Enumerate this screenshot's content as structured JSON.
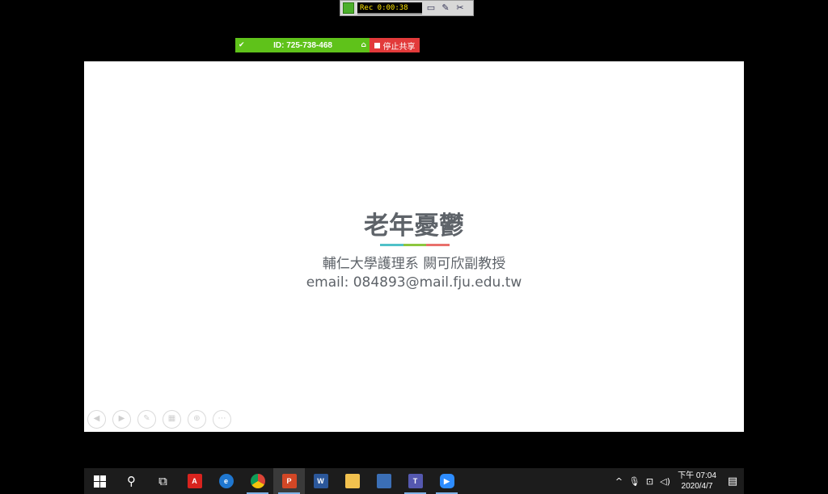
{
  "recorder": {
    "time": "Rec 0:00:38"
  },
  "share_bar": {
    "meeting_id": "ID: 725-738-468",
    "stop_label": "停止共享"
  },
  "slide": {
    "title": "老年憂鬱",
    "subtitle_line1": "輔仁大學護理系 闕可欣副教授",
    "subtitle_line2": "email: 084893@mail.fju.edu.tw",
    "rule_colors": [
      "#4fc1c8",
      "#8dc63f",
      "#e9706b"
    ]
  },
  "taskbar": {
    "apps": [
      "windows-start",
      "search",
      "task-view",
      "acrobat",
      "edge",
      "chrome",
      "powerpoint",
      "word",
      "file-explorer",
      "remote-app",
      "teams",
      "zoom"
    ],
    "clock_time": "下午 07:04",
    "clock_date": "2020/4/7"
  }
}
